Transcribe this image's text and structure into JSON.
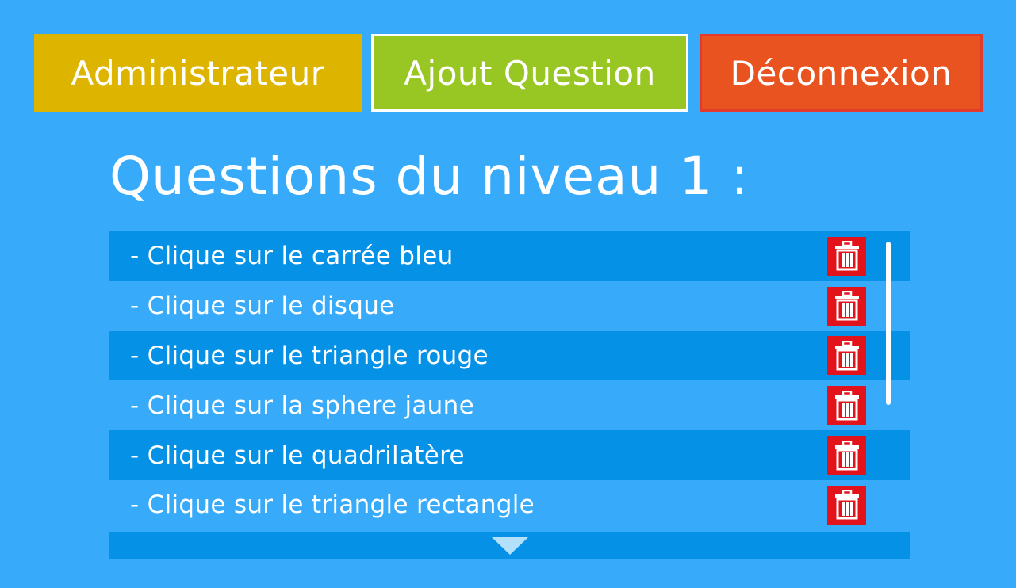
{
  "nav": {
    "admin_label": "Administrateur",
    "add_question_label": "Ajout Question",
    "logout_label": "Déconnexion"
  },
  "page": {
    "title": "Questions du niveau 1 :"
  },
  "questions": [
    {
      "text": "- Clique sur le carrée bleu"
    },
    {
      "text": "- Clique sur le disque"
    },
    {
      "text": "- Clique sur le triangle rouge"
    },
    {
      "text": "- Clique sur la sphere jaune"
    },
    {
      "text": "- Clique sur le quadrilatère"
    },
    {
      "text": "- Clique sur le triangle rectangle"
    }
  ],
  "icons": {
    "delete": "trash-icon",
    "scroll_down": "triangle-down-icon"
  },
  "colors": {
    "background": "#37aaf9",
    "row_highlight": "#0591e6",
    "admin": "#ddb500",
    "add_question": "#98c623",
    "logout": "#e9531f",
    "delete": "#e3131b"
  }
}
